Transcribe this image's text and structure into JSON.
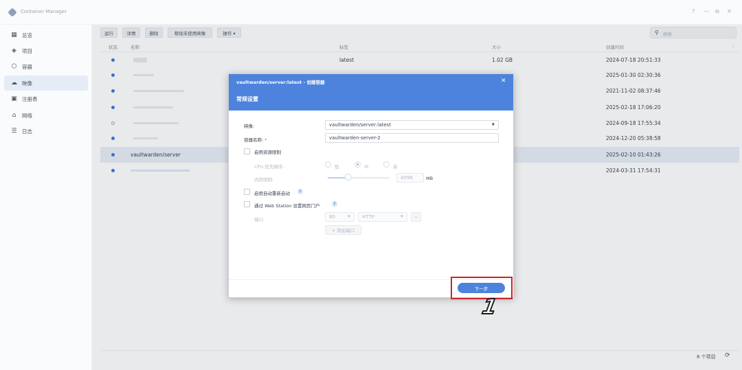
{
  "app": {
    "title": "Container Manager"
  },
  "window_controls": [
    "?",
    "—",
    "⧉",
    "✕"
  ],
  "sidebar": {
    "items": [
      {
        "label": "总览",
        "icon": "dashboard-icon",
        "glyph": "▦"
      },
      {
        "label": "项目",
        "icon": "layers-icon",
        "glyph": "◈"
      },
      {
        "label": "容器",
        "icon": "container-icon",
        "glyph": "⬡"
      },
      {
        "label": "映像",
        "icon": "cloud-icon",
        "glyph": "☁",
        "active": true
      },
      {
        "label": "注册表",
        "icon": "registry-icon",
        "glyph": "▣"
      },
      {
        "label": "网络",
        "icon": "network-icon",
        "glyph": "⌂"
      },
      {
        "label": "日志",
        "icon": "log-list-icon",
        "glyph": "☰"
      }
    ]
  },
  "toolbar": {
    "run": "运行",
    "details": "详情",
    "delete": "删除",
    "remove_unused": "移除未使用映像",
    "actions": "操作 ▾",
    "search_placeholder": "搜索"
  },
  "table": {
    "columns": [
      "状态",
      "名称",
      "标签",
      "大小",
      "创建时间"
    ],
    "rows": [
      {
        "running": true,
        "name": "",
        "tag": "latest",
        "size": "1.02 GB",
        "created": "2024-07-18 20:51:33"
      },
      {
        "running": true,
        "name": "",
        "tag": "",
        "size": "",
        "created": "2025-01-30 02:30:36"
      },
      {
        "running": true,
        "name": "",
        "tag": "",
        "size": "",
        "created": "2021-11-02 08:37:46"
      },
      {
        "running": true,
        "name": "",
        "tag": "",
        "size": "",
        "created": "2025-02-18 17:06:20"
      },
      {
        "running": false,
        "name": "",
        "tag": "",
        "size": "",
        "created": "2024-09-18 17:55:34"
      },
      {
        "running": true,
        "name": "",
        "tag": "",
        "size": "",
        "created": "2024-12-20 05:38:58"
      },
      {
        "running": true,
        "name": "vaultwarden/server",
        "tag": "",
        "size": "",
        "created": "2025-02-10 01:43:26",
        "selected": true
      },
      {
        "running": true,
        "name": "",
        "tag": "",
        "size": "",
        "created": "2024-03-31 17:54:31"
      }
    ],
    "footer_count": "8 个项目"
  },
  "dialog": {
    "title": "vaultwarden/server:latest - 创建容器",
    "section": "常规设置",
    "image_label": "映像:",
    "image_value": "vaultwarden/server:latest",
    "name_label": "容器名称:",
    "name_required": "*",
    "name_value": "vaultwarden-server-2",
    "resource_limit_label": "启用资源限制",
    "cpu_priority_label": "CPU 优先顺序:",
    "cpu_low": "低",
    "cpu_mid": "中",
    "cpu_high": "高",
    "cpu_selected": "中",
    "memory_label": "内存限制:",
    "memory_value": "4096",
    "memory_unit": "MB",
    "memory_level_fraction": 0.33,
    "auto_restart_label": "启用自动重新启动",
    "web_station_label": "通过 Web Station 设置网页门户",
    "port_label": "端口:",
    "port_value": "80",
    "protocol_value": "HTTP",
    "remove_port": "—",
    "add_port": "+ 添加端口",
    "next_button": "下一步"
  },
  "annotation": {
    "step": "1",
    "highlight_color": "#c8252a"
  }
}
